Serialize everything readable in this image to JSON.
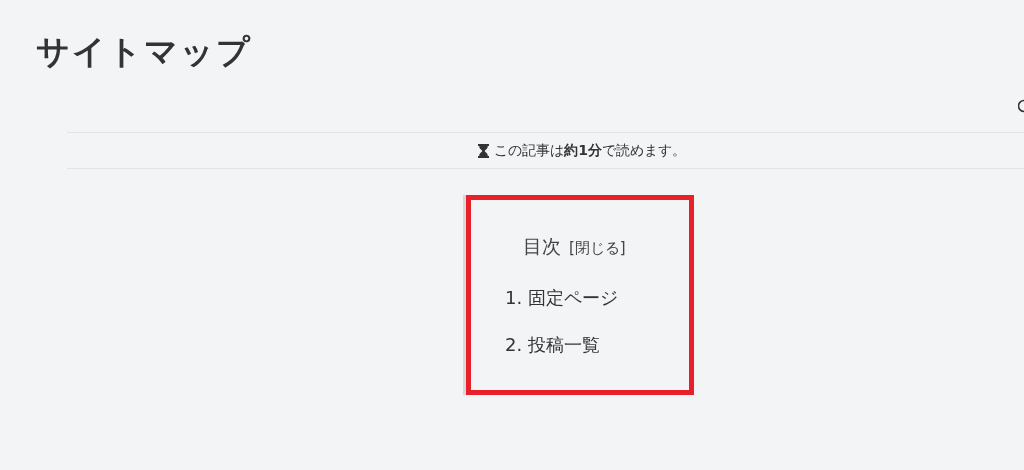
{
  "page_title": "サイトマップ",
  "reading_time": {
    "text": "この記事は**約1分**で読めます。"
  },
  "toc": {
    "title": "目次",
    "toggle": "[閉じる]",
    "highlighted": true,
    "items": [
      {
        "number": "1.",
        "label": "固定ページ"
      },
      {
        "number": "2.",
        "label": "投稿一覧"
      }
    ]
  }
}
